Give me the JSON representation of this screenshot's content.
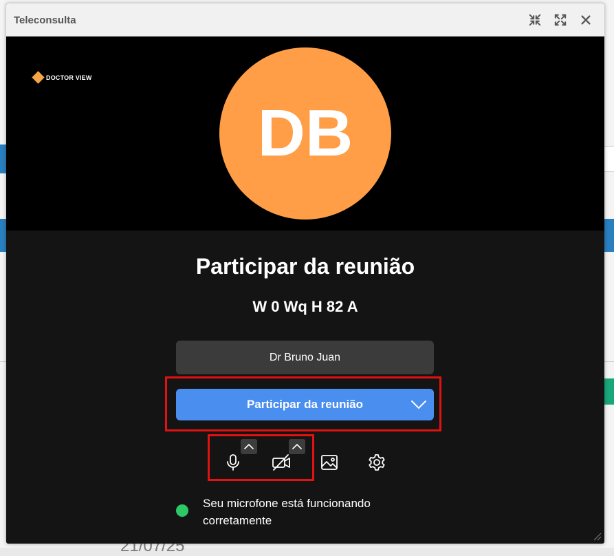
{
  "background": {
    "date_fragment": "21/07/25"
  },
  "window": {
    "title": "Teleconsulta",
    "buttons": {
      "minimize_icon": "compress-arrows-icon",
      "maximize_icon": "expand-arrows-icon",
      "close_icon": "close-icon"
    }
  },
  "video": {
    "brand": "DOCTOR VIEW",
    "avatar_initials": "DB",
    "avatar_color": "#ff9e46"
  },
  "join": {
    "heading": "Participar da reunião",
    "meeting_code": "W 0 Wq H 82 A",
    "name_value": "Dr Bruno Juan",
    "join_button_label": "Participar da reunião",
    "join_button_color": "#4a8ef0"
  },
  "controls": {
    "microphone_icon": "microphone-icon",
    "camera_icon": "camera-off-icon",
    "background_icon": "image-icon",
    "settings_icon": "gear-icon"
  },
  "status": {
    "text": "Seu microfone está funcionando corretamente",
    "color": "#2ec866"
  }
}
